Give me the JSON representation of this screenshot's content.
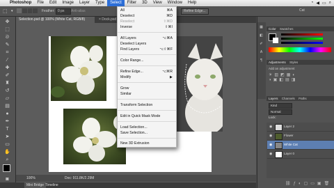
{
  "menubar": {
    "app": "Photoshop",
    "items": [
      "File",
      "Edit",
      "Image",
      "Layer",
      "Type",
      "Select",
      "Filter",
      "3D",
      "View",
      "Window",
      "Help"
    ],
    "active": "Select"
  },
  "options": {
    "feather_label": "Feather:",
    "feather_value": "0 px",
    "antialias": "Anti-alias",
    "refine": "Refine Edge..."
  },
  "tabs": [
    {
      "label": "Selection.psd @ 100% (White Cat, RGB/8)"
    },
    {
      "label": "× Dock.psd @ 100"
    }
  ],
  "title_right": "Cat",
  "menu": {
    "items": [
      {
        "label": "All",
        "shortcut": "⌘A",
        "disabled": false
      },
      {
        "label": "Deselect",
        "shortcut": "⌘D",
        "disabled": false
      },
      {
        "label": "Reselect",
        "shortcut": "⇧⌘D",
        "disabled": true
      },
      {
        "label": "Inverse",
        "shortcut": "⇧⌘I",
        "disabled": false
      },
      {
        "label": "All Layers",
        "shortcut": "⌥⌘A",
        "disabled": false
      },
      {
        "label": "Deselect Layers",
        "shortcut": "",
        "disabled": false
      },
      {
        "label": "Find Layers",
        "shortcut": "⌥⇧⌘F",
        "disabled": false
      },
      {
        "label": "Color Range...",
        "shortcut": "",
        "disabled": false
      },
      {
        "label": "Refine Edge...",
        "shortcut": "⌥⌘R",
        "disabled": false
      },
      {
        "label": "Modify",
        "shortcut": "▶",
        "disabled": false
      },
      {
        "label": "Grow",
        "shortcut": "",
        "disabled": false
      },
      {
        "label": "Similar",
        "shortcut": "",
        "disabled": false
      },
      {
        "label": "Transform Selection",
        "shortcut": "",
        "disabled": false
      },
      {
        "label": "Edit in Quick Mask Mode",
        "shortcut": "",
        "disabled": false
      },
      {
        "label": "Load Selection...",
        "shortcut": "",
        "disabled": false
      },
      {
        "label": "Save Selection...",
        "shortcut": "",
        "disabled": false
      },
      {
        "label": "New 3D Extrusion",
        "shortcut": "",
        "disabled": false
      }
    ]
  },
  "panels": {
    "color_tab": "Color",
    "swatches_tab": "Swatches",
    "adjustments_tab": "Adjustments",
    "styles_tab": "Styles",
    "adjust_hint": "Add an adjustment",
    "layers_tab": "Layers",
    "channels_tab": "Channels",
    "paths_tab": "Paths",
    "kind": "Kind",
    "blend": "Normal",
    "lock": "Lock:",
    "layers": [
      {
        "name": "Layer 2",
        "selected": false
      },
      {
        "name": "Flower",
        "selected": false
      },
      {
        "name": "White Cat",
        "selected": true
      },
      {
        "name": "Layer 0",
        "selected": false
      }
    ]
  },
  "status": {
    "zoom": "100%",
    "doc": "Doc: 911.8K/2.29M"
  },
  "bottom": {
    "minibridge": "Mini Bridge",
    "timeline": "Timeline"
  },
  "colors": {
    "selected_layer": "#5d7fb2",
    "menu_highlight": "#2d6fd8"
  }
}
